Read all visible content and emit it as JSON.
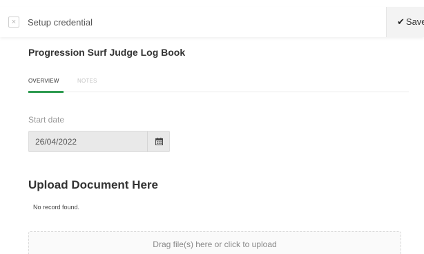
{
  "topbar": {
    "close_glyph": "×",
    "title": "Setup credential",
    "save_check": "✔",
    "save_label": "Save"
  },
  "page": {
    "title": "Progression Surf Judge Log Book"
  },
  "tabs": [
    {
      "label": "OVERVIEW",
      "active": true
    },
    {
      "label": "NOTES",
      "active": false
    }
  ],
  "form": {
    "start_date_label": "Start date",
    "start_date_value": "26/04/2022"
  },
  "upload": {
    "heading": "Upload Document Here",
    "empty_message": "No record found.",
    "dropzone_text": "Drag file(s) here or click to upload"
  },
  "icons": {
    "close": "close-icon",
    "save": "checkmark-icon",
    "date": "calendar-icon"
  },
  "colors": {
    "active_tab_underline": "#2e9b50",
    "date_field_bg": "#e9e9e9",
    "save_button_bg": "#f3f3f3"
  }
}
